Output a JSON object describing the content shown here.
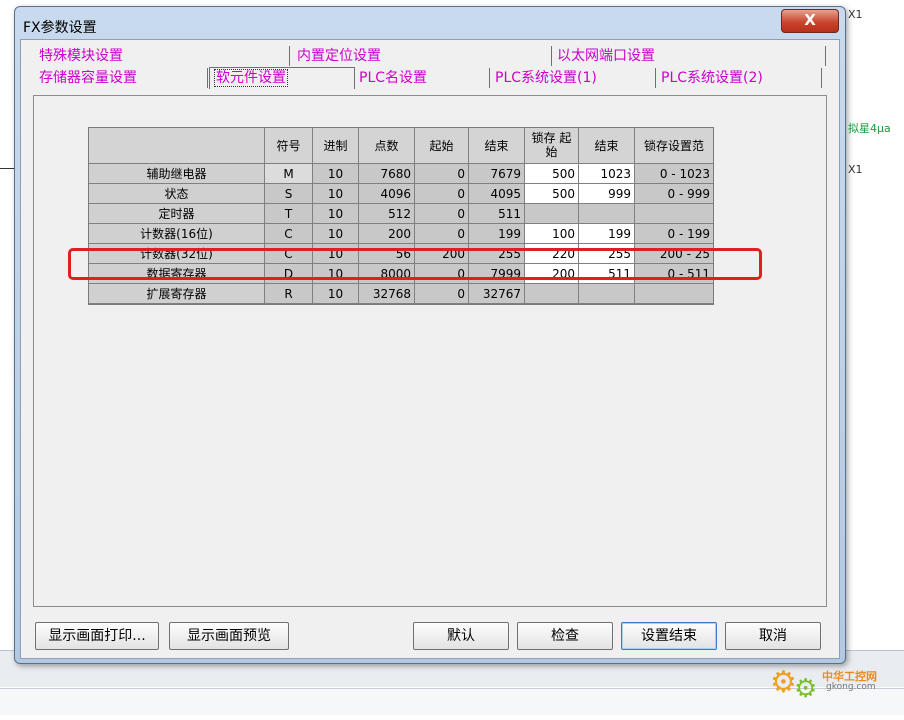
{
  "background": {
    "right_labels": [
      "X1",
      "拟星4μa",
      "X1"
    ]
  },
  "dialog": {
    "title": "FX参数设置",
    "close_label": "X"
  },
  "tabs": {
    "row1": [
      "特殊模块设置",
      "内置定位设置",
      "以太网端口设置"
    ],
    "row2": [
      "存储器容量设置",
      "软元件设置",
      "PLC名设置",
      "PLC系统设置(1)",
      "PLC系统设置(2)"
    ],
    "active": "软元件设置"
  },
  "grid": {
    "headers": [
      "",
      "符号",
      "进制",
      "点数",
      "起始",
      "结束",
      "锁存 起始",
      "结束",
      "锁存设置范"
    ],
    "rows": [
      {
        "name": "辅助继电器",
        "symbol": "M",
        "base": "10",
        "points": "7680",
        "start": "0",
        "end": "7679",
        "latch_start": "500",
        "latch_end": "1023",
        "latch_range": "0 - 1023"
      },
      {
        "name": "状态",
        "symbol": "S",
        "base": "10",
        "points": "4096",
        "start": "0",
        "end": "4095",
        "latch_start": "500",
        "latch_end": "999",
        "latch_range": "0 - 999"
      },
      {
        "name": "定时器",
        "symbol": "T",
        "base": "10",
        "points": "512",
        "start": "0",
        "end": "511",
        "latch_start": "",
        "latch_end": "",
        "latch_range": ""
      },
      {
        "name": "计数器(16位)",
        "symbol": "C",
        "base": "10",
        "points": "200",
        "start": "0",
        "end": "199",
        "latch_start": "100",
        "latch_end": "199",
        "latch_range": "0 - 199"
      },
      {
        "name": "计数器(32位)",
        "symbol": "C",
        "base": "10",
        "points": "56",
        "start": "200",
        "end": "255",
        "latch_start": "220",
        "latch_end": "255",
        "latch_range": "200 - 25"
      },
      {
        "name": "数据寄存器",
        "symbol": "D",
        "base": "10",
        "points": "8000",
        "start": "0",
        "end": "7999",
        "latch_start": "200",
        "latch_end": "511",
        "latch_range": "0 - 511"
      },
      {
        "name": "扩展寄存器",
        "symbol": "R",
        "base": "10",
        "points": "32768",
        "start": "0",
        "end": "32767",
        "latch_start": "",
        "latch_end": "",
        "latch_range": ""
      }
    ]
  },
  "buttons": {
    "print": "显示画面打印...",
    "preview": "显示画面预览",
    "default": "默认",
    "check": "检查",
    "finish": "设置结束",
    "cancel": "取消"
  },
  "watermark": {
    "text": "中华工控网",
    "url": "gkong.com"
  },
  "colors": {
    "tab_text": "#cc00cc",
    "highlight": "#e02020"
  }
}
